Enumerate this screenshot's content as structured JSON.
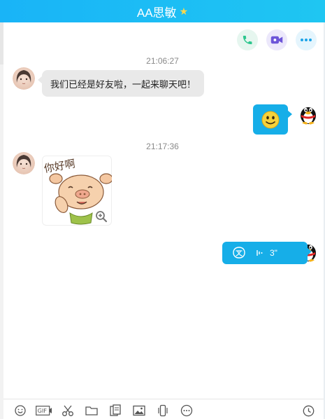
{
  "header": {
    "title": "AA思敏",
    "badge_icon": "star-icon"
  },
  "top_actions": [
    "phone-icon",
    "video-call-icon",
    "more-icon"
  ],
  "messages": {
    "time_1": "21:06:27",
    "text_1": "我们已经是好友啦，一起来聊天吧！",
    "time_2": "21:17:36",
    "sticker_text": "你好啊",
    "voice_duration": "3\""
  },
  "toolbar": [
    "emoji-icon",
    "gif-icon",
    "scissors-icon",
    "folder-icon",
    "file-icon",
    "image-icon",
    "shake-icon",
    "more-icon",
    "history-clock-icon"
  ],
  "colors": {
    "header_blue": "#19b4f7",
    "bubble_blue": "#16aee8",
    "bubble_gray": "#e9e9e9"
  }
}
